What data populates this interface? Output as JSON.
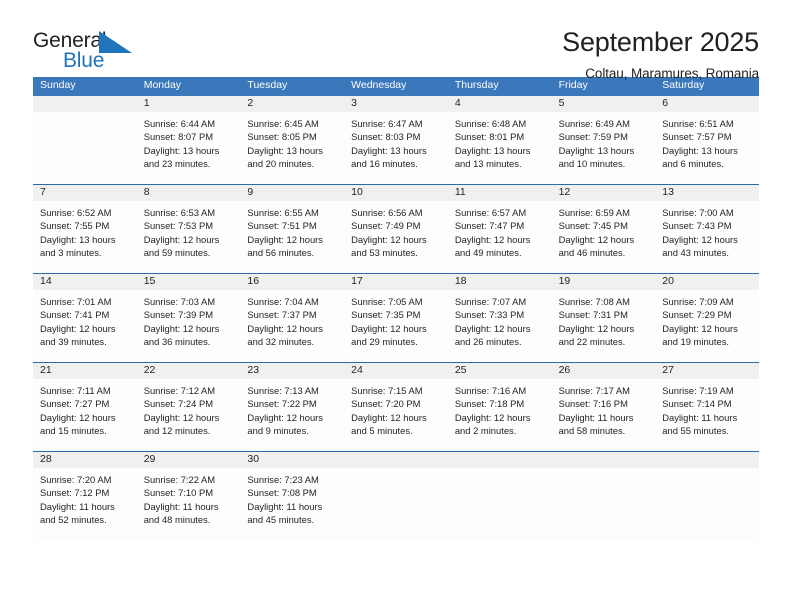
{
  "brand": {
    "name_part1": "General",
    "name_part2": "Blue",
    "flag_icon": "blue-triangle-flag-icon",
    "accent_color": "#2175bc"
  },
  "header": {
    "title": "September 2025",
    "location": "Coltau, Maramures, Romania"
  },
  "calendar": {
    "header_bg_color": "#3a77bb",
    "date_band_color": "#f0f0f0",
    "weekdays": [
      "Sunday",
      "Monday",
      "Tuesday",
      "Wednesday",
      "Thursday",
      "Friday",
      "Saturday"
    ],
    "weeks": [
      [
        {
          "day": "",
          "lines": []
        },
        {
          "day": "1",
          "lines": [
            "Sunrise: 6:44 AM",
            "Sunset: 8:07 PM",
            "Daylight: 13 hours",
            "and 23 minutes."
          ]
        },
        {
          "day": "2",
          "lines": [
            "Sunrise: 6:45 AM",
            "Sunset: 8:05 PM",
            "Daylight: 13 hours",
            "and 20 minutes."
          ]
        },
        {
          "day": "3",
          "lines": [
            "Sunrise: 6:47 AM",
            "Sunset: 8:03 PM",
            "Daylight: 13 hours",
            "and 16 minutes."
          ]
        },
        {
          "day": "4",
          "lines": [
            "Sunrise: 6:48 AM",
            "Sunset: 8:01 PM",
            "Daylight: 13 hours",
            "and 13 minutes."
          ]
        },
        {
          "day": "5",
          "lines": [
            "Sunrise: 6:49 AM",
            "Sunset: 7:59 PM",
            "Daylight: 13 hours",
            "and 10 minutes."
          ]
        },
        {
          "day": "6",
          "lines": [
            "Sunrise: 6:51 AM",
            "Sunset: 7:57 PM",
            "Daylight: 13 hours",
            "and 6 minutes."
          ]
        }
      ],
      [
        {
          "day": "7",
          "lines": [
            "Sunrise: 6:52 AM",
            "Sunset: 7:55 PM",
            "Daylight: 13 hours",
            "and 3 minutes."
          ]
        },
        {
          "day": "8",
          "lines": [
            "Sunrise: 6:53 AM",
            "Sunset: 7:53 PM",
            "Daylight: 12 hours",
            "and 59 minutes."
          ]
        },
        {
          "day": "9",
          "lines": [
            "Sunrise: 6:55 AM",
            "Sunset: 7:51 PM",
            "Daylight: 12 hours",
            "and 56 minutes."
          ]
        },
        {
          "day": "10",
          "lines": [
            "Sunrise: 6:56 AM",
            "Sunset: 7:49 PM",
            "Daylight: 12 hours",
            "and 53 minutes."
          ]
        },
        {
          "day": "11",
          "lines": [
            "Sunrise: 6:57 AM",
            "Sunset: 7:47 PM",
            "Daylight: 12 hours",
            "and 49 minutes."
          ]
        },
        {
          "day": "12",
          "lines": [
            "Sunrise: 6:59 AM",
            "Sunset: 7:45 PM",
            "Daylight: 12 hours",
            "and 46 minutes."
          ]
        },
        {
          "day": "13",
          "lines": [
            "Sunrise: 7:00 AM",
            "Sunset: 7:43 PM",
            "Daylight: 12 hours",
            "and 43 minutes."
          ]
        }
      ],
      [
        {
          "day": "14",
          "lines": [
            "Sunrise: 7:01 AM",
            "Sunset: 7:41 PM",
            "Daylight: 12 hours",
            "and 39 minutes."
          ]
        },
        {
          "day": "15",
          "lines": [
            "Sunrise: 7:03 AM",
            "Sunset: 7:39 PM",
            "Daylight: 12 hours",
            "and 36 minutes."
          ]
        },
        {
          "day": "16",
          "lines": [
            "Sunrise: 7:04 AM",
            "Sunset: 7:37 PM",
            "Daylight: 12 hours",
            "and 32 minutes."
          ]
        },
        {
          "day": "17",
          "lines": [
            "Sunrise: 7:05 AM",
            "Sunset: 7:35 PM",
            "Daylight: 12 hours",
            "and 29 minutes."
          ]
        },
        {
          "day": "18",
          "lines": [
            "Sunrise: 7:07 AM",
            "Sunset: 7:33 PM",
            "Daylight: 12 hours",
            "and 26 minutes."
          ]
        },
        {
          "day": "19",
          "lines": [
            "Sunrise: 7:08 AM",
            "Sunset: 7:31 PM",
            "Daylight: 12 hours",
            "and 22 minutes."
          ]
        },
        {
          "day": "20",
          "lines": [
            "Sunrise: 7:09 AM",
            "Sunset: 7:29 PM",
            "Daylight: 12 hours",
            "and 19 minutes."
          ]
        }
      ],
      [
        {
          "day": "21",
          "lines": [
            "Sunrise: 7:11 AM",
            "Sunset: 7:27 PM",
            "Daylight: 12 hours",
            "and 15 minutes."
          ]
        },
        {
          "day": "22",
          "lines": [
            "Sunrise: 7:12 AM",
            "Sunset: 7:24 PM",
            "Daylight: 12 hours",
            "and 12 minutes."
          ]
        },
        {
          "day": "23",
          "lines": [
            "Sunrise: 7:13 AM",
            "Sunset: 7:22 PM",
            "Daylight: 12 hours",
            "and 9 minutes."
          ]
        },
        {
          "day": "24",
          "lines": [
            "Sunrise: 7:15 AM",
            "Sunset: 7:20 PM",
            "Daylight: 12 hours",
            "and 5 minutes."
          ]
        },
        {
          "day": "25",
          "lines": [
            "Sunrise: 7:16 AM",
            "Sunset: 7:18 PM",
            "Daylight: 12 hours",
            "and 2 minutes."
          ]
        },
        {
          "day": "26",
          "lines": [
            "Sunrise: 7:17 AM",
            "Sunset: 7:16 PM",
            "Daylight: 11 hours",
            "and 58 minutes."
          ]
        },
        {
          "day": "27",
          "lines": [
            "Sunrise: 7:19 AM",
            "Sunset: 7:14 PM",
            "Daylight: 11 hours",
            "and 55 minutes."
          ]
        }
      ],
      [
        {
          "day": "28",
          "lines": [
            "Sunrise: 7:20 AM",
            "Sunset: 7:12 PM",
            "Daylight: 11 hours",
            "and 52 minutes."
          ]
        },
        {
          "day": "29",
          "lines": [
            "Sunrise: 7:22 AM",
            "Sunset: 7:10 PM",
            "Daylight: 11 hours",
            "and 48 minutes."
          ]
        },
        {
          "day": "30",
          "lines": [
            "Sunrise: 7:23 AM",
            "Sunset: 7:08 PM",
            "Daylight: 11 hours",
            "and 45 minutes."
          ]
        },
        {
          "day": "",
          "lines": []
        },
        {
          "day": "",
          "lines": []
        },
        {
          "day": "",
          "lines": []
        },
        {
          "day": "",
          "lines": []
        }
      ]
    ]
  }
}
